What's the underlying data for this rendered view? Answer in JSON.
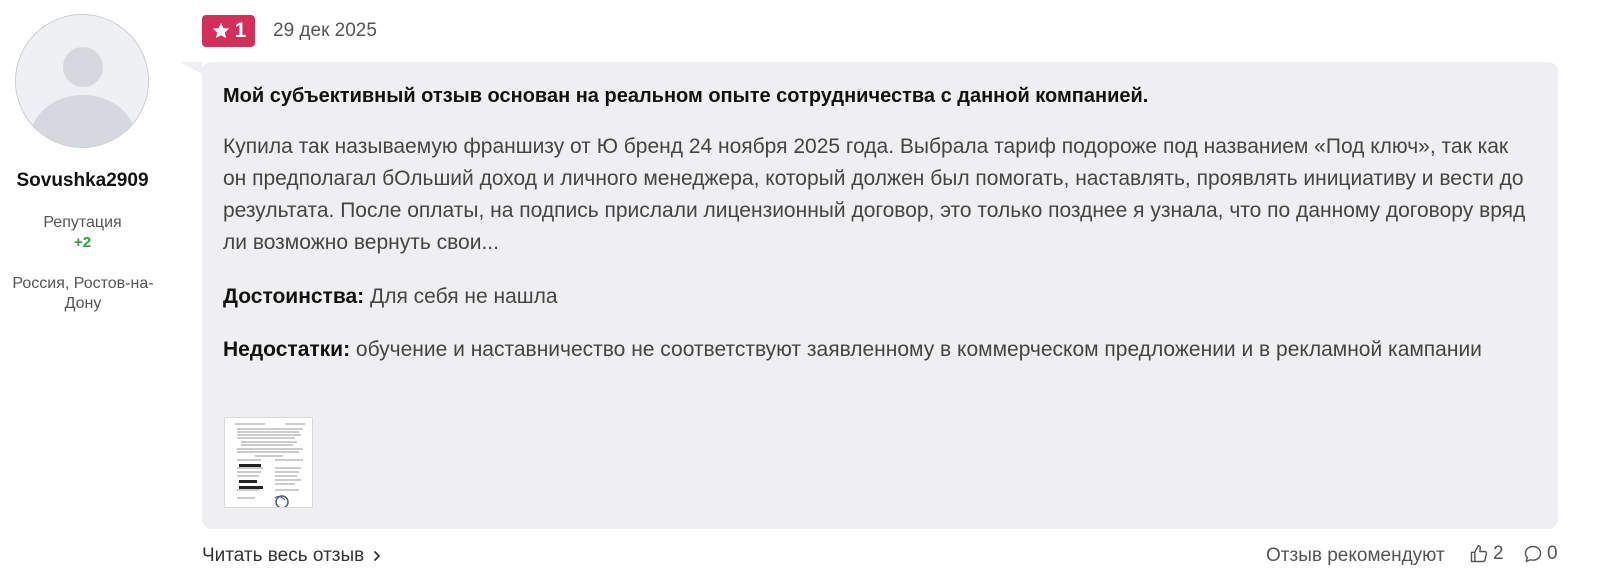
{
  "author": {
    "username": "Sovushka2909",
    "reputation_label": "Репутация",
    "reputation_value": "+2",
    "location": "Россия, Ростов-на-Дону",
    "avatar_icon": "default-user-avatar-icon"
  },
  "review": {
    "rating": "1",
    "rating_icon": "star-icon",
    "date": "29 дек 2025",
    "title": "Мой субъективный отзыв основан на реальном опыте сотрудничества с данной компанией.",
    "body": "Купила так называемую франшизу от Ю бренд 24 ноября 2025 года. Выбрала тариф подороже под названием «Под ключ», так как он предполагал бОльший доход и личного менеджера, который должен был помогать, наставлять, проявлять инициативу и вести до результата. После оплаты, на подпись прислали лицензионный договор, это только позднее я узнала, что по данному договору вряд ли возможно вернуть свои...",
    "pros_label": "Достоинства:",
    "pros_text": "Для себя не нашла",
    "cons_label": "Недостатки:",
    "cons_text": "обучение и наставничество не соответствуют заявленному в коммерческом предложении и в рекламной кампании"
  },
  "footer": {
    "read_more": "Читать весь отзыв",
    "recommend_label": "Отзыв рекомендуют",
    "likes_count": "2",
    "comments_count": "0"
  },
  "colors": {
    "badge": "#d42e5b",
    "card_bg": "#efeff1",
    "reputation": "#2e9e3a"
  }
}
